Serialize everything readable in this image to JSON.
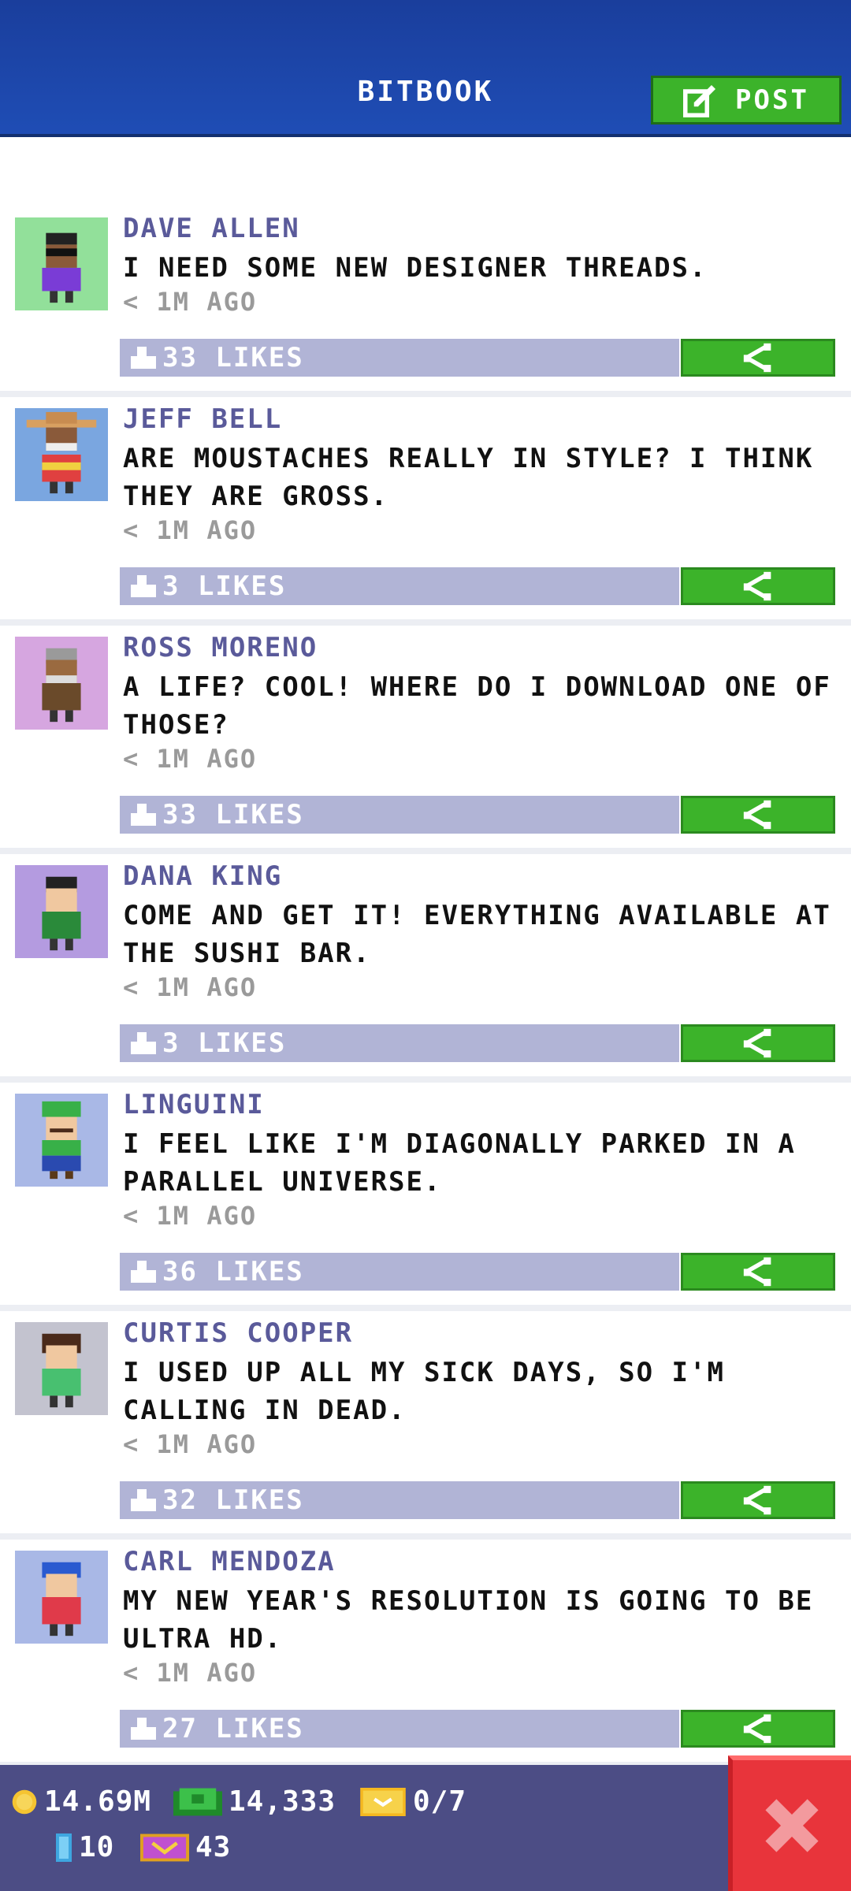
{
  "header": {
    "title": "BITBOOK",
    "post_label": "POST"
  },
  "posts": [
    {
      "name": "DAVE ALLEN",
      "message": "I NEED SOME NEW DESIGNER THREADS.",
      "time": "< 1M AGO",
      "likes": "33 LIKES",
      "avatar_bg": "#92e09a"
    },
    {
      "name": "JEFF BELL",
      "message": "ARE MOUSTACHES REALLY IN STYLE? I THINK THEY ARE GROSS.",
      "time": "< 1M AGO",
      "likes": "3 LIKES",
      "avatar_bg": "#7aa6e0"
    },
    {
      "name": "ROSS MORENO",
      "message": "A LIFE? COOL! WHERE DO I DOWNLOAD ONE OF THOSE?",
      "time": "< 1M AGO",
      "likes": "33 LIKES",
      "avatar_bg": "#d6a6e0"
    },
    {
      "name": "DANA KING",
      "message": "COME AND GET IT! EVERYTHING AVAILABLE AT THE SUSHI BAR.",
      "time": "< 1M AGO",
      "likes": "3 LIKES",
      "avatar_bg": "#b49be0"
    },
    {
      "name": "LINGUINI",
      "message": "I FEEL LIKE I'M DIAGONALLY PARKED IN A PARALLEL UNIVERSE.",
      "time": "< 1M AGO",
      "likes": "36 LIKES",
      "avatar_bg": "#a9b8e6"
    },
    {
      "name": "CURTIS COOPER",
      "message": "I USED UP ALL MY SICK DAYS, SO I'M CALLING IN DEAD.",
      "time": "< 1M AGO",
      "likes": "32 LIKES",
      "avatar_bg": "#c3c3cf"
    },
    {
      "name": "CARL MENDOZA",
      "message": "MY NEW YEAR'S RESOLUTION IS GOING TO BE ULTRA HD.",
      "time": "< 1M AGO",
      "likes": "27 LIKES",
      "avatar_bg": "#a9b8e6"
    }
  ],
  "status": {
    "coins": "14.69M",
    "bux": "14,333",
    "tickets": "0/7",
    "elevator": "10",
    "vip": "43"
  },
  "colors": {
    "header": "#1f4db5",
    "accent_green": "#3cb32a",
    "likes_bar": "#b1b4d6",
    "statusbar": "#4c4d85",
    "close_red": "#e8343b"
  }
}
